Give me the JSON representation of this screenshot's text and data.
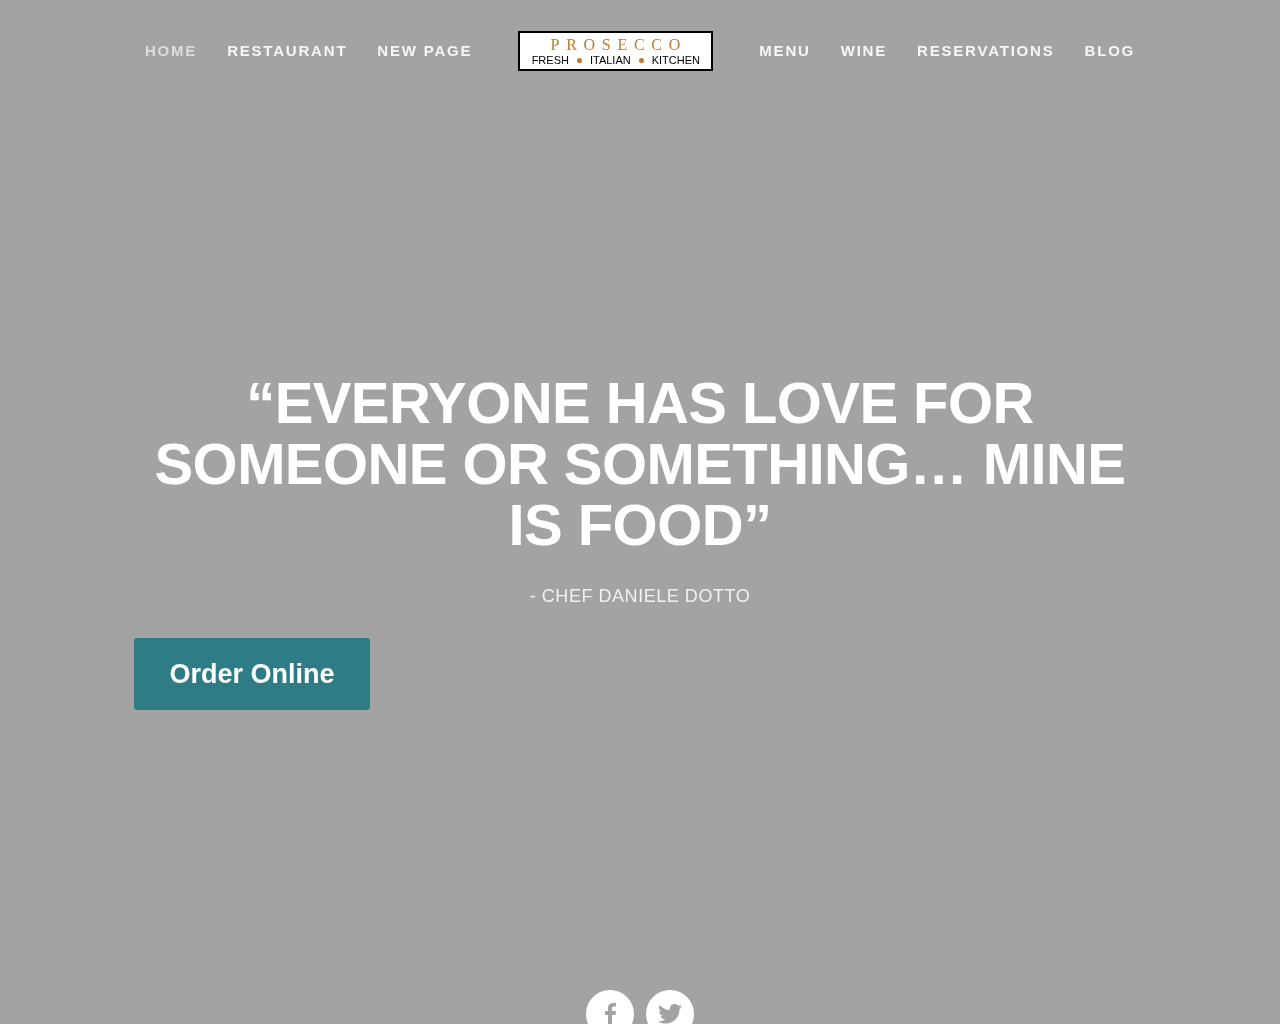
{
  "nav_left": [
    {
      "label": "HOME",
      "selected": true
    },
    {
      "label": "RESTAURANT",
      "selected": false
    },
    {
      "label": "NEW PAGE",
      "selected": false
    }
  ],
  "logo": {
    "title": "PROSECCO",
    "tagline": [
      "FRESH",
      "ITALIAN",
      "KITCHEN"
    ]
  },
  "nav_right": [
    {
      "label": "MENU",
      "selected": false
    },
    {
      "label": "WINE",
      "selected": false
    },
    {
      "label": "RESERVATIONS",
      "selected": false
    },
    {
      "label": "BLOG",
      "selected": false
    }
  ],
  "hero": {
    "quote": "“EVERYONE HAS LOVE FOR SOMEONE OR SOMETHING… MINE IS FOOD”",
    "attribution": "- CHEF DANIELE DOTTO",
    "button": "Order Online"
  },
  "social": [
    {
      "kind": "facebook"
    },
    {
      "kind": "twitter"
    }
  ]
}
